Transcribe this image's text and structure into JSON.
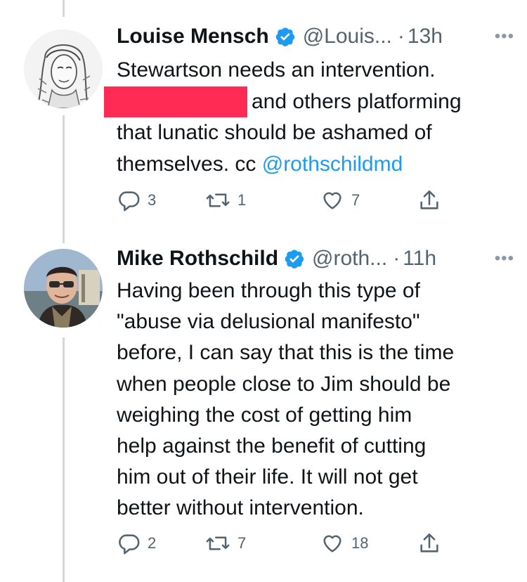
{
  "tweets": [
    {
      "author": {
        "name": "Louise Mensch",
        "handle": "@Louis...",
        "verified": true
      },
      "separator": "·",
      "time": "13h",
      "more_label": "•••",
      "body": {
        "line1": "Stewartson needs an intervention.",
        "line2_after_redaction": "and others platforming",
        "line3": "that lunatic should be ashamed of",
        "line4_prefix": "themselves. cc ",
        "line4_mention": "@rothschildmd"
      },
      "stats": {
        "replies": "3",
        "retweets": "1",
        "likes": "7"
      }
    },
    {
      "author": {
        "name": "Mike Rothschild",
        "handle": "@roth...",
        "verified": true
      },
      "separator": "·",
      "time": "11h",
      "more_label": "•••",
      "body": {
        "lines": [
          "Having been through this type of",
          "\"abuse via delusional manifesto\"",
          "before, I can say that this is the time",
          "when people close to Jim should be",
          "weighing the cost of getting him",
          "help against the benefit of cutting",
          "him out of their life. It will not get",
          "better without intervention."
        ]
      },
      "stats": {
        "replies": "2",
        "retweets": "7",
        "likes": "18"
      }
    }
  ],
  "colors": {
    "text": "#0f1419",
    "secondary": "#536471",
    "link": "#1d9bf0",
    "verified": "#1d9bf0",
    "thread_line": "#cfd9de",
    "redaction": "#ff2b54"
  }
}
